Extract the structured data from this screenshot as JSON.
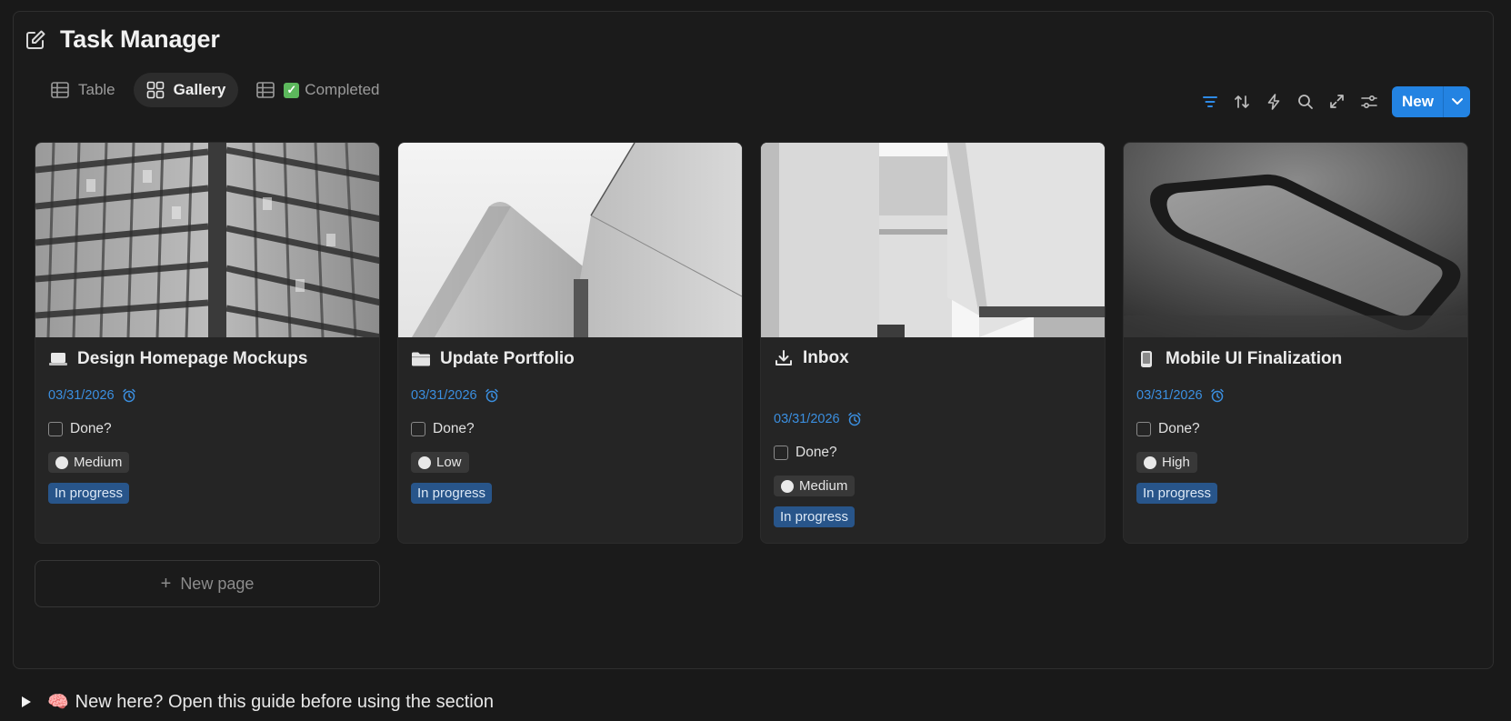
{
  "header": {
    "title": "Task Manager",
    "icon": "edit-square-icon"
  },
  "tabs": [
    {
      "label": "Table",
      "icon": "table-icon",
      "active": false
    },
    {
      "label": "Gallery",
      "icon": "gallery-grid-icon",
      "active": true
    },
    {
      "label": "Completed",
      "emoji": "✅",
      "icon": "table-icon",
      "active": false
    }
  ],
  "toolbar": {
    "icons": [
      "filter-icon",
      "sort-icon",
      "automation-bolt-icon",
      "search-icon",
      "expand-icon",
      "settings-sliders-icon"
    ],
    "new_label": "New",
    "accent": "#2383e2"
  },
  "cards": [
    {
      "title": "Design Homepage Mockups",
      "icon": "laptop-icon",
      "date": "03/31/2026",
      "done_label": "Done?",
      "done": false,
      "priority": "Medium",
      "status": "In progress"
    },
    {
      "title": "Update Portfolio",
      "icon": "folder-icon",
      "date": "03/31/2026",
      "done_label": "Done?",
      "done": false,
      "priority": "Low",
      "status": "In progress"
    },
    {
      "title": "Inbox",
      "icon": "download-icon",
      "date": "03/31/2026",
      "done_label": "Done?",
      "done": false,
      "priority": "Medium",
      "status": "In progress"
    },
    {
      "title": "Mobile UI Finalization",
      "icon": "phone-icon",
      "date": "03/31/2026",
      "done_label": "Done?",
      "done": false,
      "priority": "High",
      "status": "In progress"
    }
  ],
  "new_page_label": "New page",
  "guide": {
    "emoji": "🧠",
    "text": "New here? Open this guide before using the section"
  },
  "colors": {
    "background": "#191919",
    "card": "#252525",
    "date": "#3b8fe0",
    "status": "#28558a"
  }
}
